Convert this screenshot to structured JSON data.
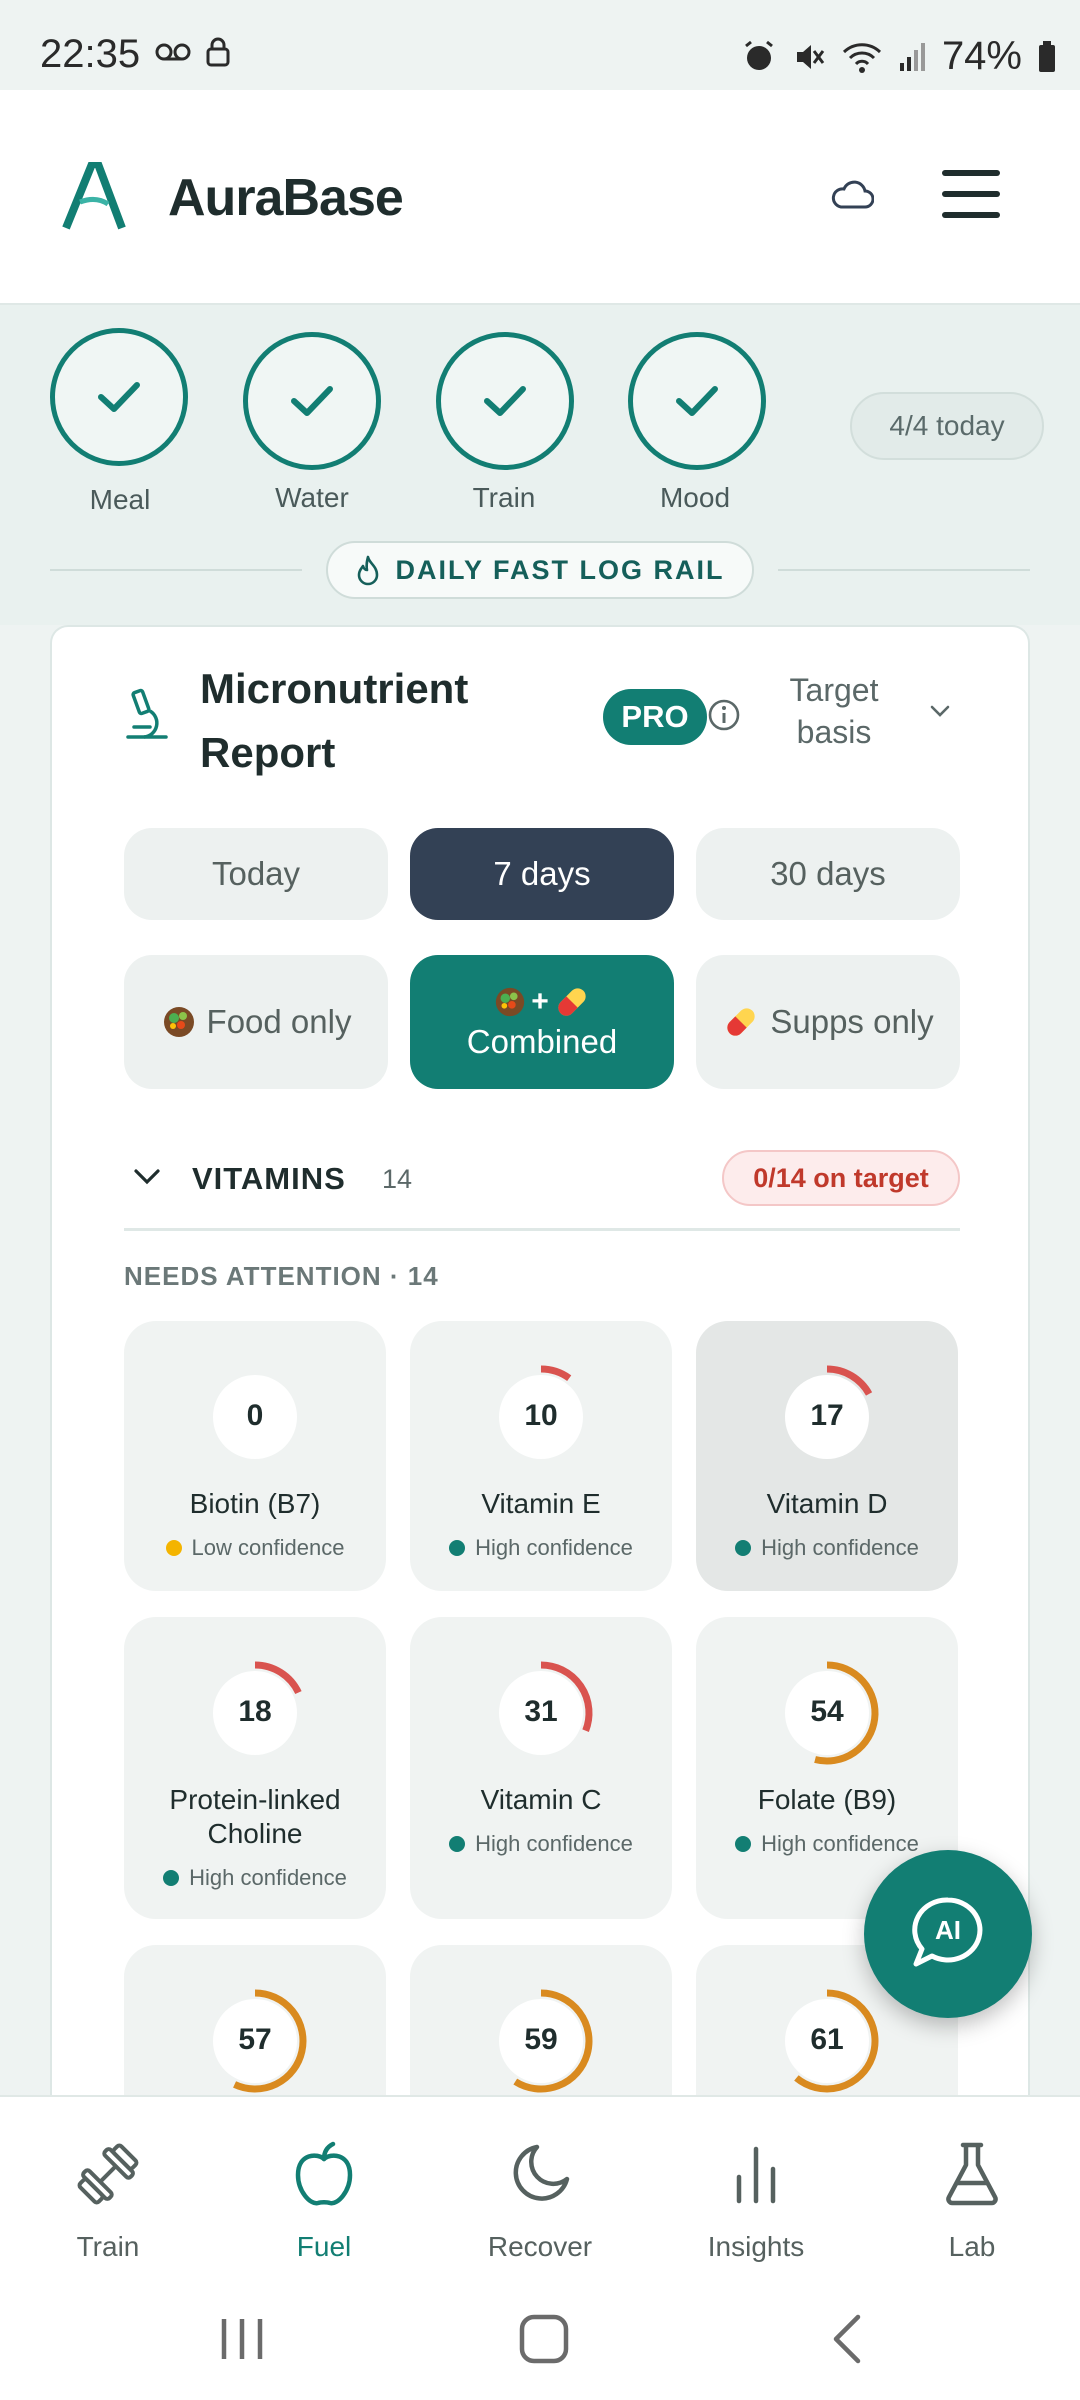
{
  "status_bar": {
    "time": "22:35",
    "battery": "74%"
  },
  "header": {
    "brand": "AuraBase",
    "logo_icon": "aurabase-logo-icon",
    "cloud_icon": "cloud-icon",
    "menu_icon": "hamburger-menu-icon"
  },
  "checklist": {
    "items": [
      {
        "label": "Meal",
        "done": true
      },
      {
        "label": "Water",
        "done": true
      },
      {
        "label": "Train",
        "done": true
      },
      {
        "label": "Mood",
        "done": true
      }
    ],
    "progress": "4/4 today",
    "rail_button": "DAILY FAST LOG RAIL"
  },
  "report": {
    "title": "Micronutrient Report",
    "badge": "PRO",
    "target_basis": "Target basis",
    "range_tabs": [
      "Today",
      "7 days",
      "30 days"
    ],
    "range_selected": "7 days",
    "source_tabs": [
      "Food only",
      "Combined",
      "Supps only"
    ],
    "source_selected": "Combined",
    "section": {
      "title": "VITAMINS",
      "count": "14",
      "status": "0/14 on target"
    },
    "needs_attention": "NEEDS ATTENTION · 14",
    "nutrients": [
      {
        "value": "0",
        "name": "Biotin (B7)",
        "confidence": "Low confidence",
        "conf_color": "#f4b400",
        "pct": 0,
        "arc_color": "#d9534f"
      },
      {
        "value": "10",
        "name": "Vitamin E",
        "confidence": "High confidence",
        "conf_color": "#127e73",
        "pct": 10,
        "arc_color": "#d9534f"
      },
      {
        "value": "17",
        "name": "Vitamin D",
        "confidence": "High confidence",
        "conf_color": "#127e73",
        "pct": 17,
        "arc_color": "#d9534f"
      },
      {
        "value": "18",
        "name": "Protein-linked Choline",
        "confidence": "High confidence",
        "conf_color": "#127e73",
        "pct": 18,
        "arc_color": "#d9534f"
      },
      {
        "value": "31",
        "name": "Vitamin C",
        "confidence": "High confidence",
        "conf_color": "#127e73",
        "pct": 31,
        "arc_color": "#d9534f"
      },
      {
        "value": "54",
        "name": "Folate (B9)",
        "confidence": "High confidence",
        "conf_color": "#127e73",
        "pct": 54,
        "arc_color": "#d98a1f"
      },
      {
        "value": "57",
        "pct": 57,
        "arc_color": "#d98a1f"
      },
      {
        "value": "59",
        "pct": 59,
        "arc_color": "#d98a1f"
      },
      {
        "value": "61",
        "pct": 61,
        "arc_color": "#d98a1f"
      }
    ]
  },
  "fab": {
    "label": "AI"
  },
  "bottom_nav": [
    {
      "label": "Train",
      "icon": "dumbbell-icon"
    },
    {
      "label": "Fuel",
      "icon": "apple-icon",
      "active": true
    },
    {
      "label": "Recover",
      "icon": "moon-icon"
    },
    {
      "label": "Insights",
      "icon": "bar-chart-icon"
    },
    {
      "label": "Lab",
      "icon": "flask-icon"
    }
  ],
  "colors": {
    "accent": "#127e73",
    "dark": "#334155",
    "warn": "#d9534f",
    "mid": "#d98a1f"
  }
}
